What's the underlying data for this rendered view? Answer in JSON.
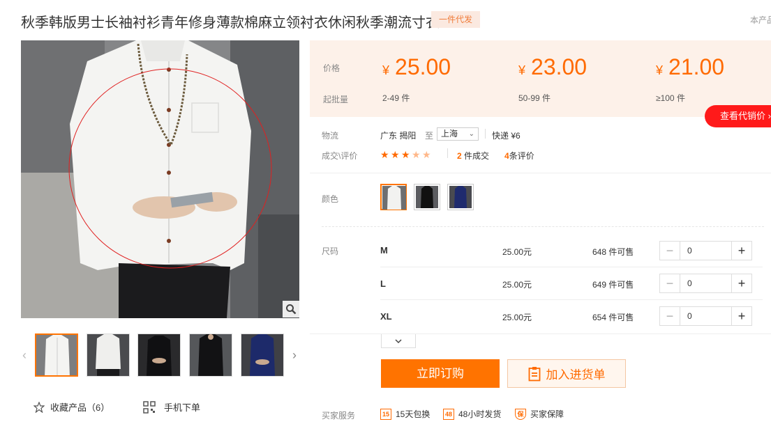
{
  "title": "秋季韩版男士长袖衬衫青年修身薄款棉麻立领衬衣休闲秋季潮流寸衣",
  "badge": "一件代发",
  "top_right": "本产品",
  "gallery": {
    "favorite_label": "收藏产品（6）",
    "mobile_label": "手机下单"
  },
  "price": {
    "price_label": "价格",
    "moq_label": "起批量",
    "currency": "¥",
    "tiers": [
      {
        "price": "25.00",
        "qty": "2-49",
        "unit": "件"
      },
      {
        "price": "23.00",
        "qty": "50-99",
        "unit": "件"
      },
      {
        "price": "21.00",
        "qty": "≥100",
        "unit": "件"
      }
    ],
    "dropship_button": "查看代销价"
  },
  "logistics": {
    "label": "物流",
    "from": "广东 揭阳",
    "to_word": "至",
    "to_value": "上海",
    "express": "快递 ¥6"
  },
  "deals": {
    "label": "成交\\评价",
    "rating": 3.5,
    "deal_count": "2",
    "deal_suffix": "件成交",
    "review_count": "4",
    "review_suffix": "条评价"
  },
  "color": {
    "label": "颜色"
  },
  "size": {
    "label": "尺码",
    "rows": [
      {
        "name": "M",
        "price": "25.00元",
        "stock": "648 件可售",
        "qty": "0"
      },
      {
        "name": "L",
        "price": "25.00元",
        "stock": "649 件可售",
        "qty": "0"
      },
      {
        "name": "XL",
        "price": "25.00元",
        "stock": "654 件可售",
        "qty": "0"
      }
    ]
  },
  "actions": {
    "buy": "立即订购",
    "cart": "加入进货单"
  },
  "services": {
    "label": "买家服务",
    "items": [
      {
        "icon": "15",
        "text": "15天包换"
      },
      {
        "icon": "48",
        "text": "48小时发货"
      },
      {
        "icon": "保",
        "text": "买家保障"
      }
    ]
  },
  "colors": {
    "accent": "#ff7300",
    "price": "#ff6a00",
    "dropship": "#ff1a1a"
  }
}
